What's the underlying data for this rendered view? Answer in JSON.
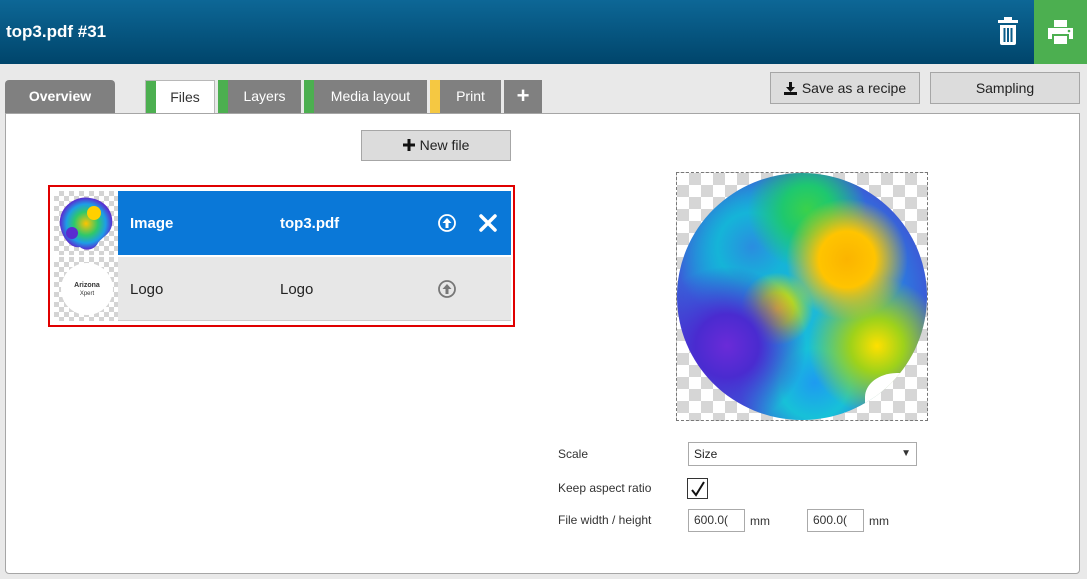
{
  "header": {
    "title": "top3.pdf #31"
  },
  "tabs": {
    "overview": "Overview",
    "files": "Files",
    "layers": "Layers",
    "media_layout": "Media layout",
    "print": "Print",
    "add": "+"
  },
  "tab_colors": {
    "files": "#4caf50",
    "layers": "#4caf50",
    "media_layout": "#4caf50",
    "print": "#f5c842"
  },
  "toolbar": {
    "save_recipe": "Save as a recipe",
    "sampling": "Sampling"
  },
  "files": {
    "new_file": "New file",
    "rows": [
      {
        "name": "Image",
        "file": "top3.pdf",
        "selected": true
      },
      {
        "name": "Logo",
        "file": "Logo",
        "selected": false
      }
    ],
    "logo_thumb": {
      "line1": "Arizona",
      "line2": "Xpert"
    }
  },
  "form": {
    "scale_label": "Scale",
    "scale_value": "Size",
    "keep_aspect_label": "Keep aspect ratio",
    "keep_aspect_checked": true,
    "file_size_label": "File width / height",
    "width": "600.0(",
    "height": "600.0(",
    "unit": "mm"
  },
  "icons": {
    "trash": "trash-icon",
    "print": "printer-icon",
    "download": "download-icon",
    "plus": "plus-icon",
    "upload": "upload-circle-icon",
    "close": "close-icon",
    "caret": "chevron-down-icon",
    "check": "check-icon"
  },
  "colors": {
    "header": "#00507e",
    "selected_row": "#0a78d8",
    "highlight_border": "#e00000",
    "print_button": "#4caf50"
  }
}
